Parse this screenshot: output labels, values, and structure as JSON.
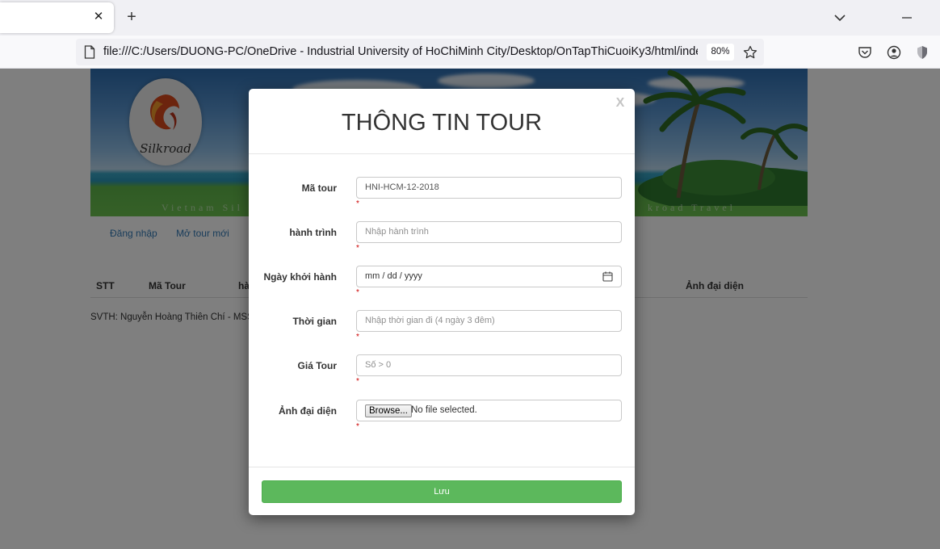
{
  "browser": {
    "tab_close": "✕",
    "new_tab": "+",
    "url": "file:///C:/Users/DUONG-PC/OneDrive - Industrial University of HoChiMinh City/Desktop/OnTapThiCuoiKy3/html/index.html",
    "zoom": "80%"
  },
  "banner": {
    "logo_text": "Silkroad",
    "left_text": "Vietnam Sil",
    "right_text": "kroad Travel"
  },
  "menu": {
    "login": "Đăng nhập",
    "new_tour": "Mở tour mới"
  },
  "table": {
    "headers": [
      "STT",
      "Mã Tour",
      "hà",
      "Ảnh đại diện"
    ]
  },
  "footer": {
    "note": "SVTH: Nguyễn Hoàng Thiên Chí - MSSV:"
  },
  "modal": {
    "title": "THÔNG TIN TOUR",
    "close": "X",
    "required_mark": "*",
    "fields": [
      {
        "label": "Mã tour",
        "value": "HNI-HCM-12-2018",
        "placeholder": ""
      },
      {
        "label": "hành trình",
        "value": "",
        "placeholder": "Nhập hành trình"
      },
      {
        "label": "Ngày khởi hành",
        "value": "mm / dd / yyyy",
        "placeholder": ""
      },
      {
        "label": "Thời gian",
        "value": "",
        "placeholder": "Nhập thời gian đi (4 ngày 3 đêm)"
      },
      {
        "label": "Giá Tour",
        "value": "",
        "placeholder": "Số > 0"
      },
      {
        "label": "Ảnh đại diện",
        "button": "Browse...",
        "status": "No file selected."
      }
    ],
    "save": "Lưu"
  }
}
